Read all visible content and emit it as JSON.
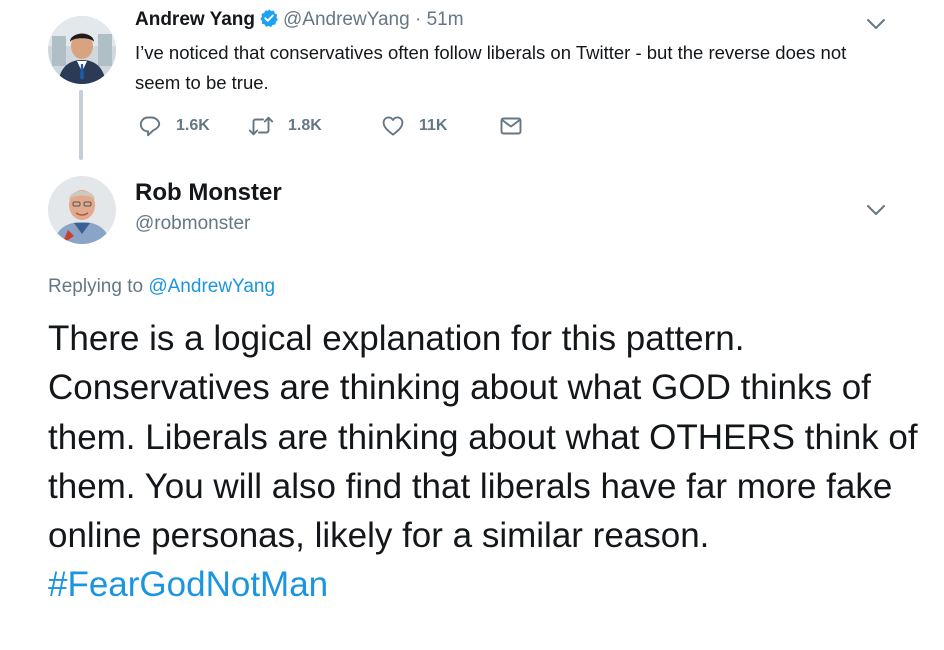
{
  "tweet1": {
    "author_name": "Andrew Yang",
    "handle": "@AndrewYang",
    "separator": "·",
    "time": "51m",
    "text": "I’ve noticed that conservatives often follow liberals on Twitter - but the reverse does not seem to be true.",
    "reply_count": "1.6K",
    "retweet_count": "1.8K",
    "like_count": "11K"
  },
  "tweet2": {
    "author_name": "Rob Monster",
    "handle": "@robmonster",
    "replying_prefix": "Replying to",
    "replying_to": "@AndrewYang",
    "text": "There is a logical explanation for this pattern. Conservatives are thinking about what GOD thinks of them. Liberals are thinking about what OTHERS think of them. You will also find that liberals have far more fake online personas, likely for a similar reason.",
    "hashtag": "#FearGodNotMan"
  },
  "icons": {
    "verified": "verified-badge-icon",
    "reply": "reply-icon",
    "retweet": "retweet-icon",
    "like": "heart-icon",
    "message": "envelope-icon",
    "menu": "chevron-down-icon"
  },
  "colors": {
    "link": "#1b95e0",
    "secondary_text": "#657786",
    "primary_text": "#14171a",
    "verified": "#1da1f2"
  }
}
